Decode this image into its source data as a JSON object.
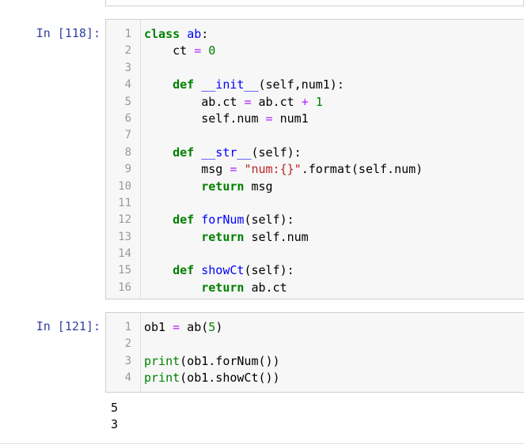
{
  "cells": [
    {
      "prompt": "In [118]:",
      "lines": [
        {
          "n": "1",
          "tokens": [
            {
              "t": "class",
              "c": "kw"
            },
            {
              "t": " "
            },
            {
              "t": "ab",
              "c": "def"
            },
            {
              "t": ":"
            }
          ]
        },
        {
          "n": "2",
          "tokens": [
            {
              "t": "    ct "
            },
            {
              "t": "=",
              "c": "op"
            },
            {
              "t": " "
            },
            {
              "t": "0",
              "c": "num"
            }
          ]
        },
        {
          "n": "3",
          "tokens": []
        },
        {
          "n": "4",
          "tokens": [
            {
              "t": "    "
            },
            {
              "t": "def",
              "c": "kw"
            },
            {
              "t": " "
            },
            {
              "t": "__init__",
              "c": "def"
            },
            {
              "t": "(self,num1):"
            }
          ]
        },
        {
          "n": "5",
          "tokens": [
            {
              "t": "        ab.ct "
            },
            {
              "t": "=",
              "c": "op"
            },
            {
              "t": " ab.ct "
            },
            {
              "t": "+",
              "c": "op"
            },
            {
              "t": " "
            },
            {
              "t": "1",
              "c": "num"
            }
          ]
        },
        {
          "n": "6",
          "tokens": [
            {
              "t": "        self.num "
            },
            {
              "t": "=",
              "c": "op"
            },
            {
              "t": " num1"
            }
          ]
        },
        {
          "n": "7",
          "tokens": []
        },
        {
          "n": "8",
          "tokens": [
            {
              "t": "    "
            },
            {
              "t": "def",
              "c": "kw"
            },
            {
              "t": " "
            },
            {
              "t": "__str__",
              "c": "def"
            },
            {
              "t": "(self):"
            }
          ]
        },
        {
          "n": "9",
          "tokens": [
            {
              "t": "        msg "
            },
            {
              "t": "=",
              "c": "op"
            },
            {
              "t": " "
            },
            {
              "t": "\"num:{}\"",
              "c": "str"
            },
            {
              "t": ".format(self.num)"
            }
          ]
        },
        {
          "n": "10",
          "tokens": [
            {
              "t": "        "
            },
            {
              "t": "return",
              "c": "kw"
            },
            {
              "t": " msg"
            }
          ]
        },
        {
          "n": "11",
          "tokens": []
        },
        {
          "n": "12",
          "tokens": [
            {
              "t": "    "
            },
            {
              "t": "def",
              "c": "kw"
            },
            {
              "t": " "
            },
            {
              "t": "forNum",
              "c": "def"
            },
            {
              "t": "(self):"
            }
          ]
        },
        {
          "n": "13",
          "tokens": [
            {
              "t": "        "
            },
            {
              "t": "return",
              "c": "kw"
            },
            {
              "t": " self.num"
            }
          ]
        },
        {
          "n": "14",
          "tokens": []
        },
        {
          "n": "15",
          "tokens": [
            {
              "t": "    "
            },
            {
              "t": "def",
              "c": "kw"
            },
            {
              "t": " "
            },
            {
              "t": "showCt",
              "c": "def"
            },
            {
              "t": "(self):"
            }
          ]
        },
        {
          "n": "16",
          "tokens": [
            {
              "t": "        "
            },
            {
              "t": "return",
              "c": "kw"
            },
            {
              "t": " ab.ct"
            }
          ]
        }
      ]
    },
    {
      "prompt": "In [121]:",
      "lines": [
        {
          "n": "1",
          "tokens": [
            {
              "t": "ob1 "
            },
            {
              "t": "=",
              "c": "op"
            },
            {
              "t": " ab("
            },
            {
              "t": "5",
              "c": "num"
            },
            {
              "t": ")"
            }
          ]
        },
        {
          "n": "2",
          "tokens": []
        },
        {
          "n": "3",
          "tokens": [
            {
              "t": "print",
              "c": "bi"
            },
            {
              "t": "(ob1.forNum())"
            }
          ]
        },
        {
          "n": "4",
          "tokens": [
            {
              "t": "print",
              "c": "bi"
            },
            {
              "t": "(ob1.showCt())"
            }
          ]
        }
      ]
    }
  ],
  "output": [
    "5",
    "3"
  ]
}
